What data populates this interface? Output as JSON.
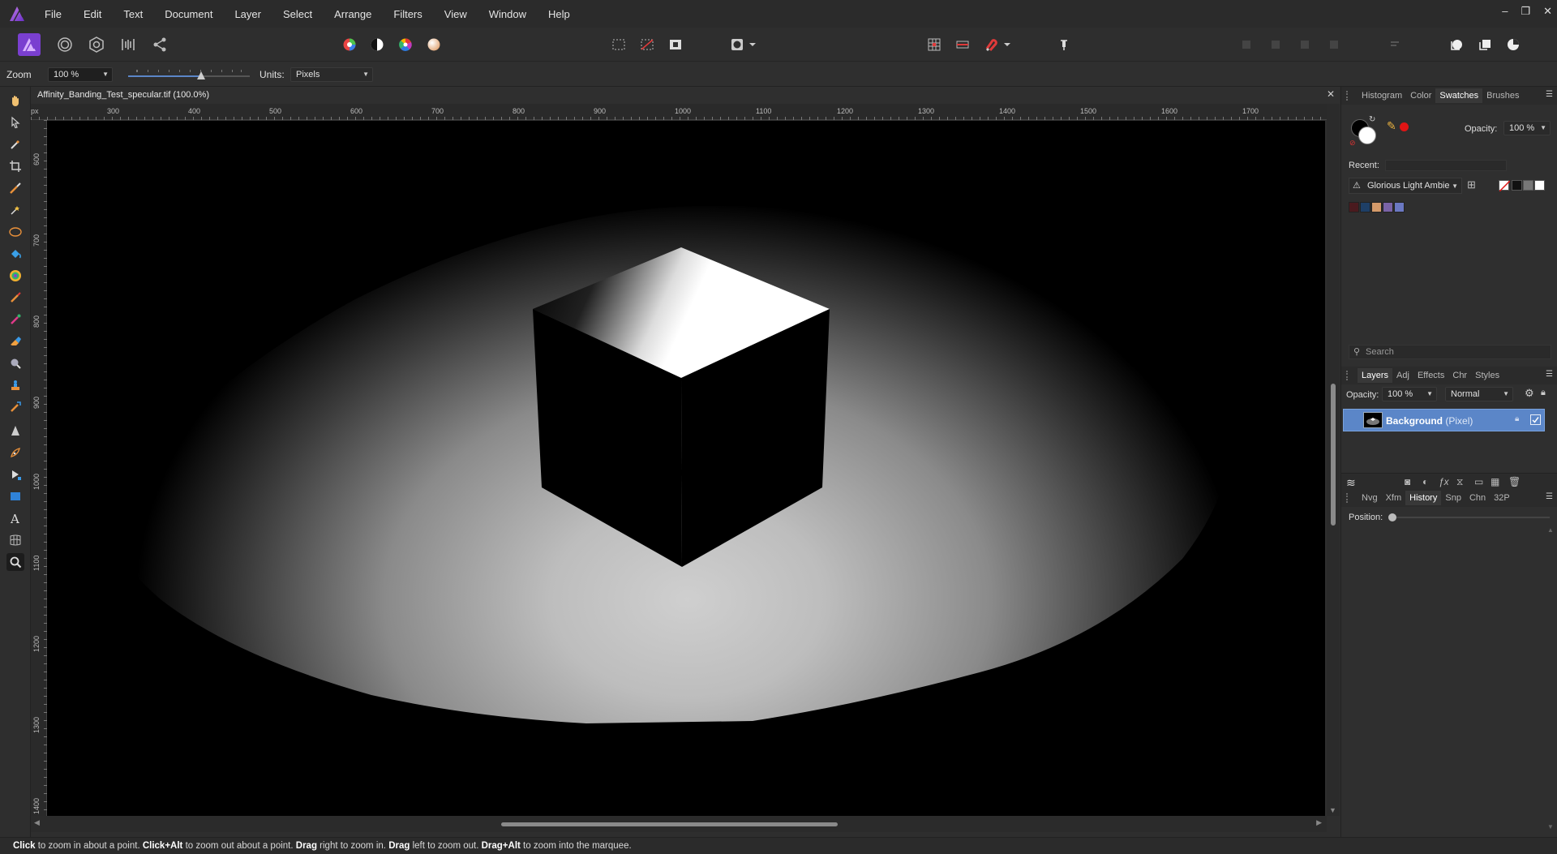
{
  "menu": [
    "File",
    "Edit",
    "Text",
    "Document",
    "Layer",
    "Select",
    "Arrange",
    "Filters",
    "View",
    "Window",
    "Help"
  ],
  "window_controls": [
    "–",
    "❐",
    "✕"
  ],
  "context": {
    "zoom_label": "Zoom",
    "zoom_value": "100 %",
    "zoom_slider_fraction": 0.6,
    "units_label": "Units:",
    "units_value": "Pixels"
  },
  "document": {
    "title": "Affinity_Banding_Test_specular.tif (100.0%)",
    "close": "✕"
  },
  "ruler": {
    "unit": "px",
    "h_ticks": [
      "300",
      "400",
      "500",
      "600",
      "700",
      "800",
      "900",
      "1000",
      "1100",
      "1200",
      "1300",
      "1400",
      "1500",
      "1600",
      "1700"
    ],
    "v_ticks": [
      "600",
      "700",
      "800",
      "900",
      "1000",
      "1100",
      "1200",
      "1300",
      "1400"
    ]
  },
  "swatches_panel": {
    "tabs": [
      "Histogram",
      "Color",
      "Swatches",
      "Brushes"
    ],
    "active_tab": "Swatches",
    "opacity_label": "Opacity:",
    "opacity_value": "100 %",
    "recent_label": "Recent:",
    "palette_name": "Glorious Light Ambie",
    "palette_colors": [
      "#4a1a1e",
      "#1e3f66",
      "#d49a6a",
      "#7a63a6",
      "#6b78c2"
    ],
    "search_placeholder": "Search"
  },
  "layers_panel": {
    "tabs": [
      "Layers",
      "Adj",
      "Effects",
      "Chr",
      "Styles"
    ],
    "active_tab": "Layers",
    "opacity_label": "Opacity:",
    "opacity_value": "100 %",
    "blend_mode": "Normal",
    "layer_name": "Background",
    "layer_kind": "(Pixel)"
  },
  "history_panel": {
    "tabs": [
      "Nvg",
      "Xfm",
      "History",
      "Snp",
      "Chn",
      "32P"
    ],
    "active_tab": "History",
    "position_label": "Position:"
  },
  "status": {
    "parts": [
      {
        "b": "Click",
        "t": " to zoom in about a point. "
      },
      {
        "b": "Click+Alt",
        "t": " to zoom out about a point. "
      },
      {
        "b": "Drag",
        "t": " right to zoom in. "
      },
      {
        "b": "Drag",
        "t": " left to zoom out. "
      },
      {
        "b": "Drag+Alt",
        "t": " to zoom into the marquee."
      }
    ]
  },
  "colors": {
    "accent": "#5b86c8",
    "brand": "#8b4dd8",
    "primary_fill": "#000000",
    "secondary_fill": "#ffffff",
    "record_red": "#e01515"
  }
}
